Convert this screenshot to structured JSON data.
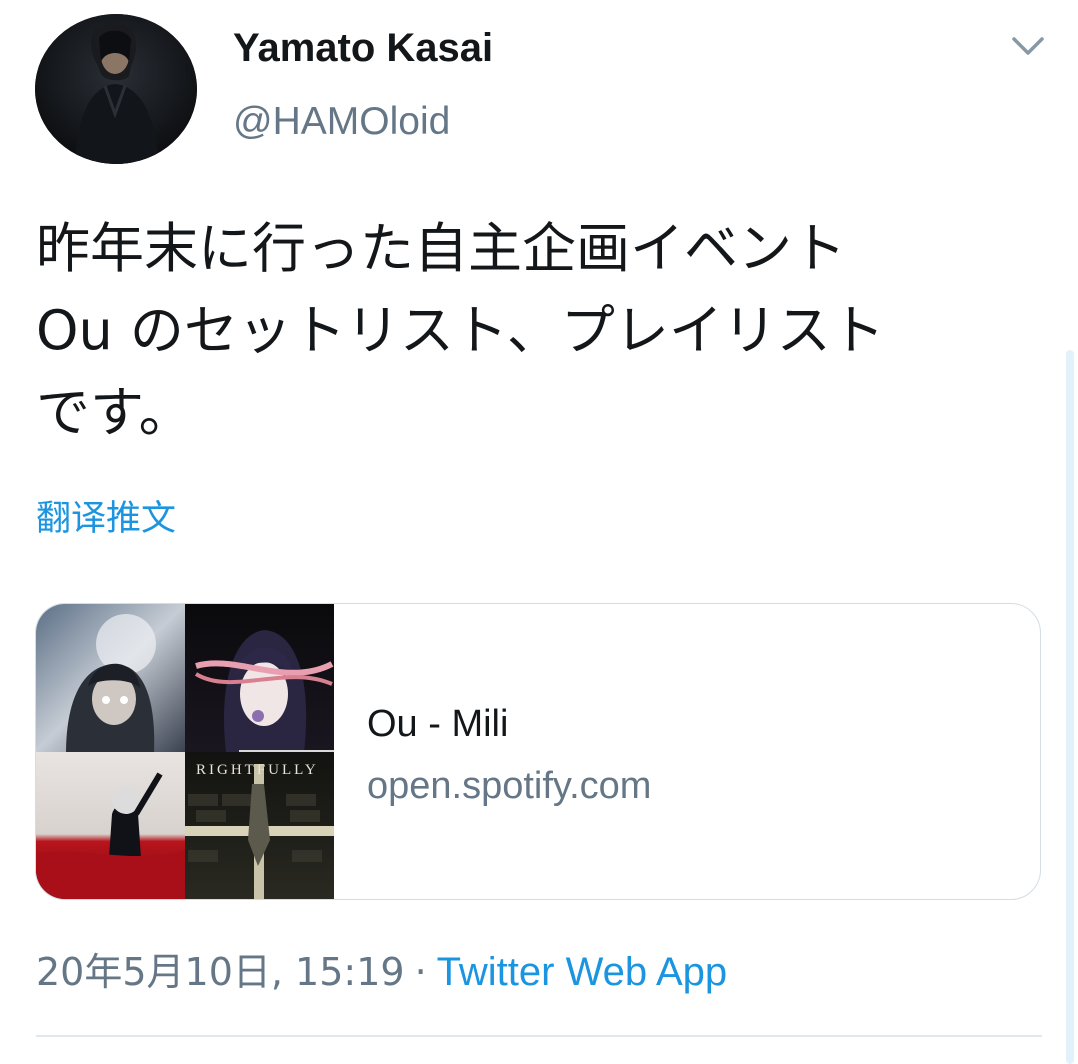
{
  "tweet": {
    "author": {
      "display_name": "Yamato Kasai",
      "handle": "@HAMOloid"
    },
    "text": "昨年末に行った自主企画イベント\nOu のセットリスト、プレイリスト\nです。",
    "translate_label": "翻译推文",
    "card": {
      "title": "Ou - Mili",
      "domain": "open.spotify.com",
      "artwork_text": "RIGHTFULLY"
    },
    "timestamp": "20年5月10日, 15:19",
    "separator": "·",
    "source": "Twitter Web App"
  },
  "icons": {
    "menu": "chevron-down-icon"
  },
  "colors": {
    "link": "#1b95e0",
    "secondary_text": "#657786",
    "primary_text": "#14171a",
    "border": "#d4dde3"
  }
}
